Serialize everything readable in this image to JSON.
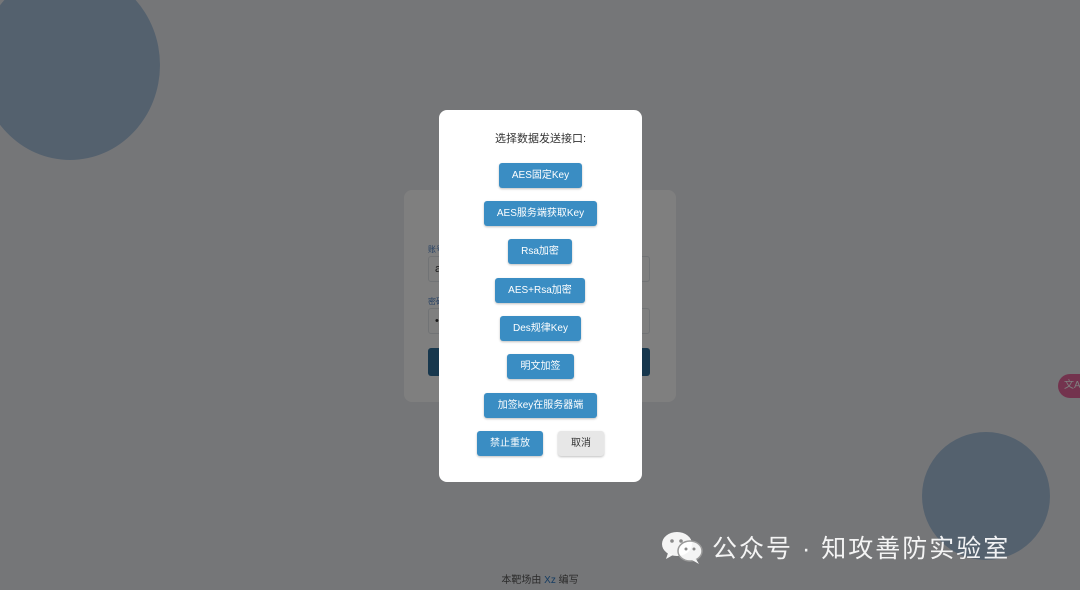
{
  "login": {
    "username_label": "账号",
    "username_value": "a",
    "password_label": "密码",
    "password_value": "•"
  },
  "dialog": {
    "title": "选择数据发送接口:",
    "buttons": [
      "AES固定Key",
      "AES服务端获取Key",
      "Rsa加密",
      "AES+Rsa加密",
      "Des规律Key",
      "明文加签",
      "加签key在服务器端",
      "禁止重放"
    ],
    "cancel_label": "取消"
  },
  "footer": {
    "prefix": "本靶场由 ",
    "author": "Xz",
    "suffix": " 编写"
  },
  "side_tab": {
    "label": "文A"
  },
  "watermark": {
    "text": "公众号 · 知攻善防实验室",
    "icon": "wechat-icon"
  },
  "colors": {
    "primary_button": "#3a8dc3",
    "cancel_button": "#e7e7e7",
    "overlay": "rgba(0,0,0,0.5)",
    "accent_circle": "#a9c2dd",
    "side_tab": "#e6679c"
  }
}
